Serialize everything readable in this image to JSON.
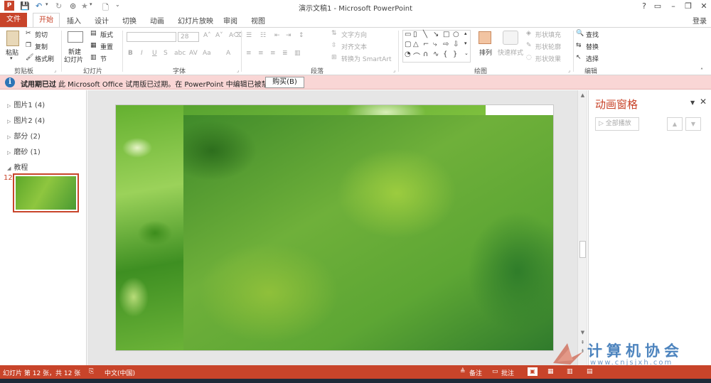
{
  "app": {
    "window_title": "演示文稿1 - Microsoft PowerPoint",
    "signin": "登录",
    "window_controls": [
      "?",
      "▭",
      "–",
      "❐",
      "✕"
    ]
  },
  "tabs": [
    "文件",
    "开始",
    "插入",
    "设计",
    "切换",
    "动画",
    "幻灯片放映",
    "审阅",
    "视图"
  ],
  "ribbon": {
    "clipboard": {
      "paste": "粘贴",
      "cut": "剪切",
      "copy": "复制",
      "format_painter": "格式刷",
      "label": "剪贴板"
    },
    "slides": {
      "new_slide": "新建",
      "new_slide_2": "幻灯片",
      "layout": "版式",
      "reset": "重置",
      "section": "节",
      "label": "幻灯片"
    },
    "font": {
      "size": "28",
      "label": "字体"
    },
    "paragraph": {
      "text_direction": "文字方向",
      "align_text": "对齐文本",
      "convert_smartart": "转换为 SmartArt",
      "label": "段落"
    },
    "drawing": {
      "arrange": "排列",
      "quick_styles": "快速样式",
      "shape_fill": "形状填充",
      "shape_outline": "形状轮廓",
      "shape_effects": "形状效果",
      "label": "绘图"
    },
    "editing": {
      "find": "查找",
      "replace": "替换",
      "select": "选择",
      "label": "编辑"
    }
  },
  "message_bar": {
    "title": "试用期已过",
    "text": "此 Microsoft Office 试用版已过期。在 PowerPoint 中编辑已被禁用。",
    "button": "购买(B)"
  },
  "thumbnail_pane": {
    "sections": [
      {
        "label": "图片1 (4)",
        "expanded": false
      },
      {
        "label": "图片2 (4)",
        "expanded": false
      },
      {
        "label": "部分 (2)",
        "expanded": false
      },
      {
        "label": "磨砂 (1)",
        "expanded": false
      },
      {
        "label": "教程",
        "expanded": true
      }
    ],
    "current_slide_number": "12"
  },
  "scrollbar": {
    "position": 0.67
  },
  "animation_pane": {
    "title": "动画窗格",
    "play_all": "全部播放"
  },
  "watermark": {
    "text": "计算机协会",
    "url": "www.cnjsjxh.com"
  },
  "status_bar": {
    "slide_info": "幻灯片 第 12 张，共 12 张",
    "language": "中文(中国)",
    "notes": "备注",
    "comments": "批注"
  },
  "colors": {
    "accent": "#c8442a",
    "message_bar": "#f9d6d5",
    "watermark": "#2f6fb3"
  }
}
